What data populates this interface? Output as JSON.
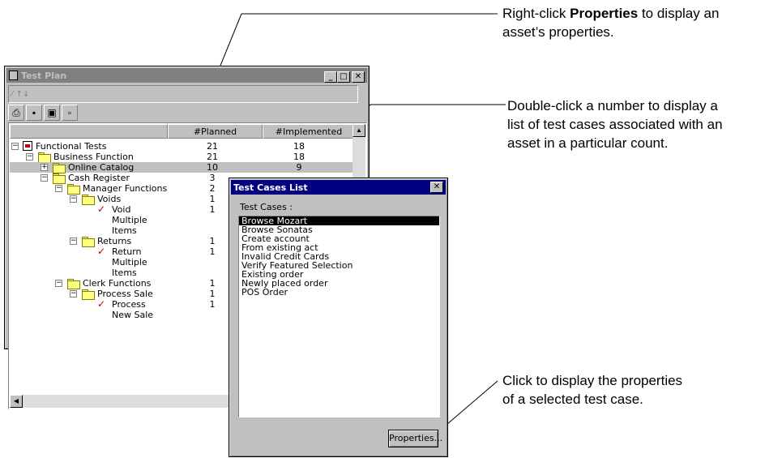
{
  "callouts": {
    "properties_pre": "Right-click ",
    "properties_bold": "Properties",
    "properties_post": " to display an",
    "properties_line2": "asset’s properties.",
    "number_line1": "Double-click a number to display a",
    "number_line2": "list of test cases associated with an",
    "number_line3": "asset in a particular count.",
    "button_line1": "Click to display the properties",
    "button_line2": "of a selected test case."
  },
  "test_plan": {
    "title": "Test Plan",
    "columns": [
      "",
      "#Planned",
      "#Implemented"
    ],
    "rows": [
      {
        "label": "Functional Tests",
        "planned": "21",
        "implemented": "18"
      },
      {
        "label": "Business Function",
        "planned": "21",
        "implemented": "18"
      },
      {
        "label": "Online Catalog",
        "planned": "10",
        "implemented": "9"
      },
      {
        "label": "Cash Register",
        "planned": "3",
        "implemented": ""
      },
      {
        "label": "Manager Functions",
        "planned": "2",
        "implemented": ""
      },
      {
        "label": "Voids",
        "planned": "1",
        "implemented": ""
      },
      {
        "label": "Void",
        "planned": "1",
        "implemented": ""
      },
      {
        "label": "Multiple",
        "planned": "",
        "implemented": ""
      },
      {
        "label": "Items",
        "planned": "",
        "implemented": ""
      },
      {
        "label": "Returns",
        "planned": "1",
        "implemented": ""
      },
      {
        "label": "Return",
        "planned": "1",
        "implemented": ""
      },
      {
        "label": "Multiple",
        "planned": "",
        "implemented": ""
      },
      {
        "label": "Items",
        "planned": "",
        "implemented": ""
      },
      {
        "label": "Clerk Functions",
        "planned": "1",
        "implemented": ""
      },
      {
        "label": "Process Sale",
        "planned": "1",
        "implemented": ""
      },
      {
        "label": "Process",
        "planned": "1",
        "implemented": ""
      },
      {
        "label": "New Sale",
        "planned": "",
        "implemented": ""
      }
    ]
  },
  "test_cases_dialog": {
    "title": "Test Cases List",
    "label": "Test Cases :",
    "items": [
      "Browse Mozart",
      "Browse Sonatas",
      "Create account",
      "From existing act",
      "Invalid Credit Cards",
      "Verify  Featured Selection",
      "Existing order",
      "Newly placed order",
      "POS Order"
    ],
    "selected_index": 0,
    "properties_button": "Properties...",
    "close_glyph": "✕"
  },
  "icons": {
    "minimize": "_",
    "maximize": "□",
    "close": "✕",
    "scroll_up": "▲",
    "scroll_left": "◀",
    "checkmark": "✓",
    "expand_minus": "−",
    "expand_plus": "+"
  }
}
